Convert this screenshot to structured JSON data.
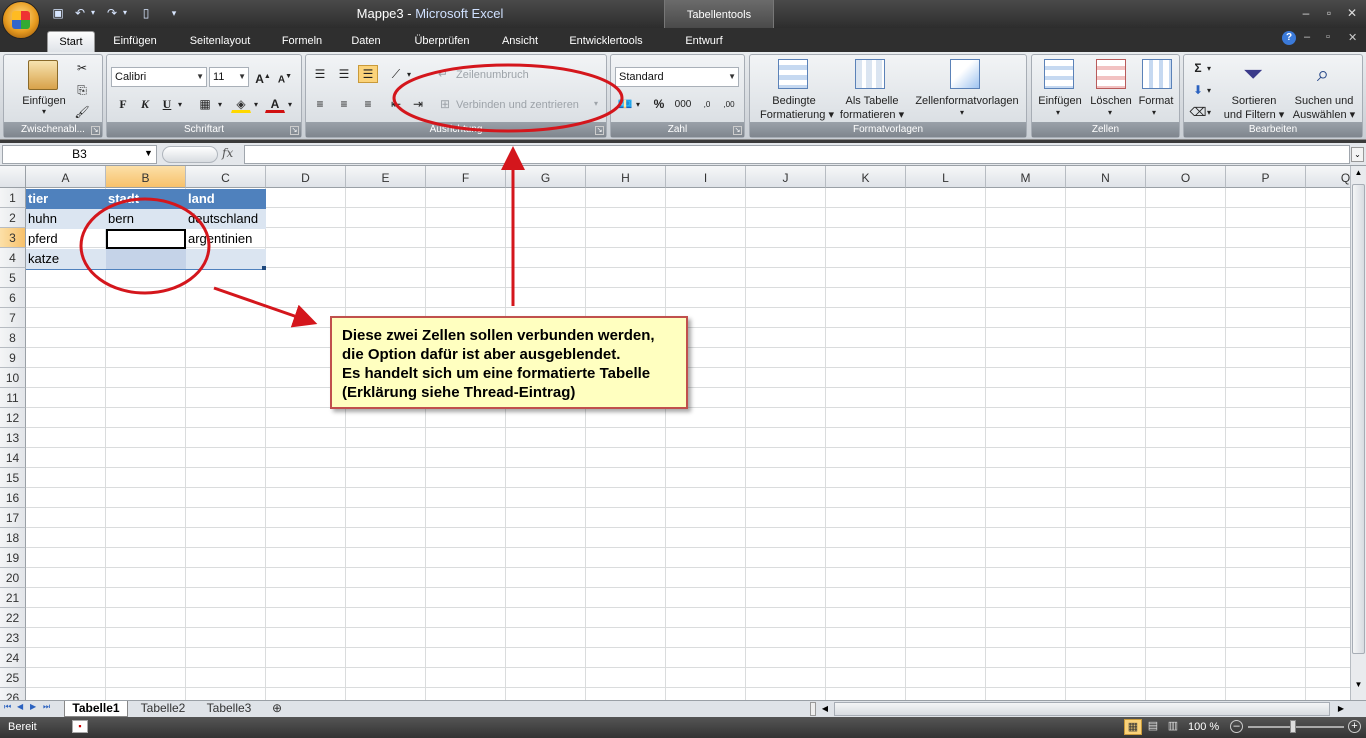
{
  "title": {
    "doc": "Mappe3",
    "sep": " - ",
    "app": "Microsoft Excel",
    "context_tab_group": "Tabellentools"
  },
  "tabs": [
    "Start",
    "Einfügen",
    "Seitenlayout",
    "Formeln",
    "Daten",
    "Überprüfen",
    "Ansicht",
    "Entwicklertools",
    "Entwurf"
  ],
  "ribbon": {
    "clipboard": {
      "label": "Zwischenabl...",
      "paste": "Einfügen"
    },
    "font": {
      "label": "Schriftart",
      "name": "Calibri",
      "size": "11",
      "bold": "F",
      "italic": "K",
      "underline": "U"
    },
    "alignment": {
      "label": "Ausrichtung",
      "wrap": "Zeilenumbruch",
      "merge": "Verbinden und zentrieren"
    },
    "number": {
      "label": "Zahl",
      "format": "Standard",
      "percent": "%",
      "thousands": "000"
    },
    "styles": {
      "label": "Formatvorlagen",
      "cond1": "Bedingte",
      "cond2": "Formatierung",
      "table1": "Als Tabelle",
      "table2": "formatieren",
      "cellstyles": "Zellenformatvorlagen"
    },
    "cells": {
      "label": "Zellen",
      "insert": "Einfügen",
      "delete": "Löschen",
      "format": "Format"
    },
    "editing": {
      "label": "Bearbeiten",
      "sort1": "Sortieren",
      "sort2": "und Filtern",
      "find1": "Suchen und",
      "find2": "Auswählen"
    }
  },
  "formula_bar": {
    "name_box": "B3",
    "fx": "fx",
    "value": ""
  },
  "columns": [
    "A",
    "B",
    "C",
    "D",
    "E",
    "F",
    "G",
    "H",
    "I",
    "J",
    "K",
    "L",
    "M",
    "N",
    "O",
    "P",
    "Q"
  ],
  "rows": [
    "1",
    "2",
    "3",
    "4",
    "5",
    "6",
    "7",
    "8",
    "9",
    "10",
    "11",
    "12",
    "13",
    "14",
    "15",
    "16",
    "17",
    "18",
    "19",
    "20",
    "21",
    "22",
    "23",
    "24",
    "25",
    "26"
  ],
  "table": {
    "headers": [
      "tier",
      "stadt",
      "land"
    ],
    "rows": [
      [
        "huhn",
        "bern",
        "deutschland"
      ],
      [
        "pferd",
        "",
        "argentinien"
      ],
      [
        "katze",
        "",
        ""
      ]
    ]
  },
  "callout": {
    "lines": [
      "Diese zwei Zellen sollen verbunden werden,",
      "die Option dafür ist aber ausgeblendet.",
      "Es handelt sich um eine formatierte Tabelle",
      "(Erklärung siehe Thread-Eintrag)"
    ]
  },
  "sheets": [
    "Tabelle1",
    "Tabelle2",
    "Tabelle3"
  ],
  "status": {
    "ready": "Bereit",
    "zoom": "100 %"
  },
  "colors": {
    "accent_red": "#d4161c",
    "table_header": "#4f81bd",
    "table_band": "#dbe5f1",
    "callout_bg": "#ffffc0"
  }
}
